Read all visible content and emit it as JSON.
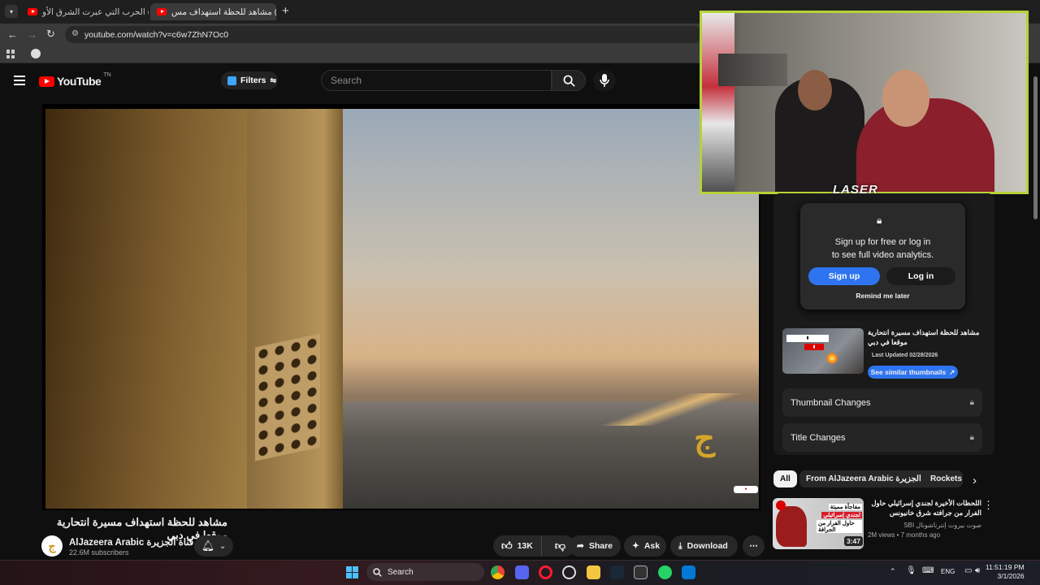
{
  "browser": {
    "tabs": [
      {
        "title": "(26) الحرب التي عبرت الشرق الأو",
        "active": false
      },
      {
        "title": "(26) مشاهد للحظة استهداف مس",
        "active": true
      }
    ],
    "new_tab": "+",
    "url": "youtube.com/watch?v=c6w7ZhN7Oc0"
  },
  "youtube": {
    "logo": "YouTube",
    "country": "TN",
    "filters_label": "Filters",
    "search_placeholder": "Search"
  },
  "video": {
    "title": "مشاهد للحظة استهداف مسيرة انتحارية موقعا في دبي",
    "channel": "AlJazeera Arabic قناة الجزيرة",
    "subscribers": "22.6M subscribers",
    "likes": "13K",
    "share": "Share",
    "ask": "Ask",
    "download": "Download"
  },
  "overlay": {
    "streamer_logo": "LASER"
  },
  "analytics": {
    "signup_text_1": "Sign up for free or log in",
    "signup_text_2": "to see full video analytics.",
    "signup": "Sign up",
    "login": "Log in",
    "remind": "Remind me later",
    "video_title": "مشاهد للحظة استهداف مسيرة انتحارية موقعا في دبي",
    "last_updated": "Last Updated 02/28/2026",
    "see_similar": "See similar thumbnails",
    "thumbnail_changes": "Thumbnail Changes",
    "title_changes": "Title Changes"
  },
  "chips": [
    "All",
    "From AlJazeera Arabic قناة الجزيرة",
    "Rockets"
  ],
  "recommended": [
    {
      "title": "اللحظات الأخيرة لجندي إسرائيلي حاول الفرار من جرافته شرق خانيونس",
      "channel": "صوت بيروت إنترناشونال SBI",
      "meta": "2M views • 7 months ago",
      "duration": "3:47",
      "banner": [
        "مفاجأة مميتة",
        "لجندي إسرائيلي",
        "حاول الفرار من الجرافة"
      ]
    }
  ],
  "taskbar": {
    "search": "Search",
    "lang": "ENG",
    "time": "11:51:19 PM",
    "date": "3/1/2026"
  }
}
